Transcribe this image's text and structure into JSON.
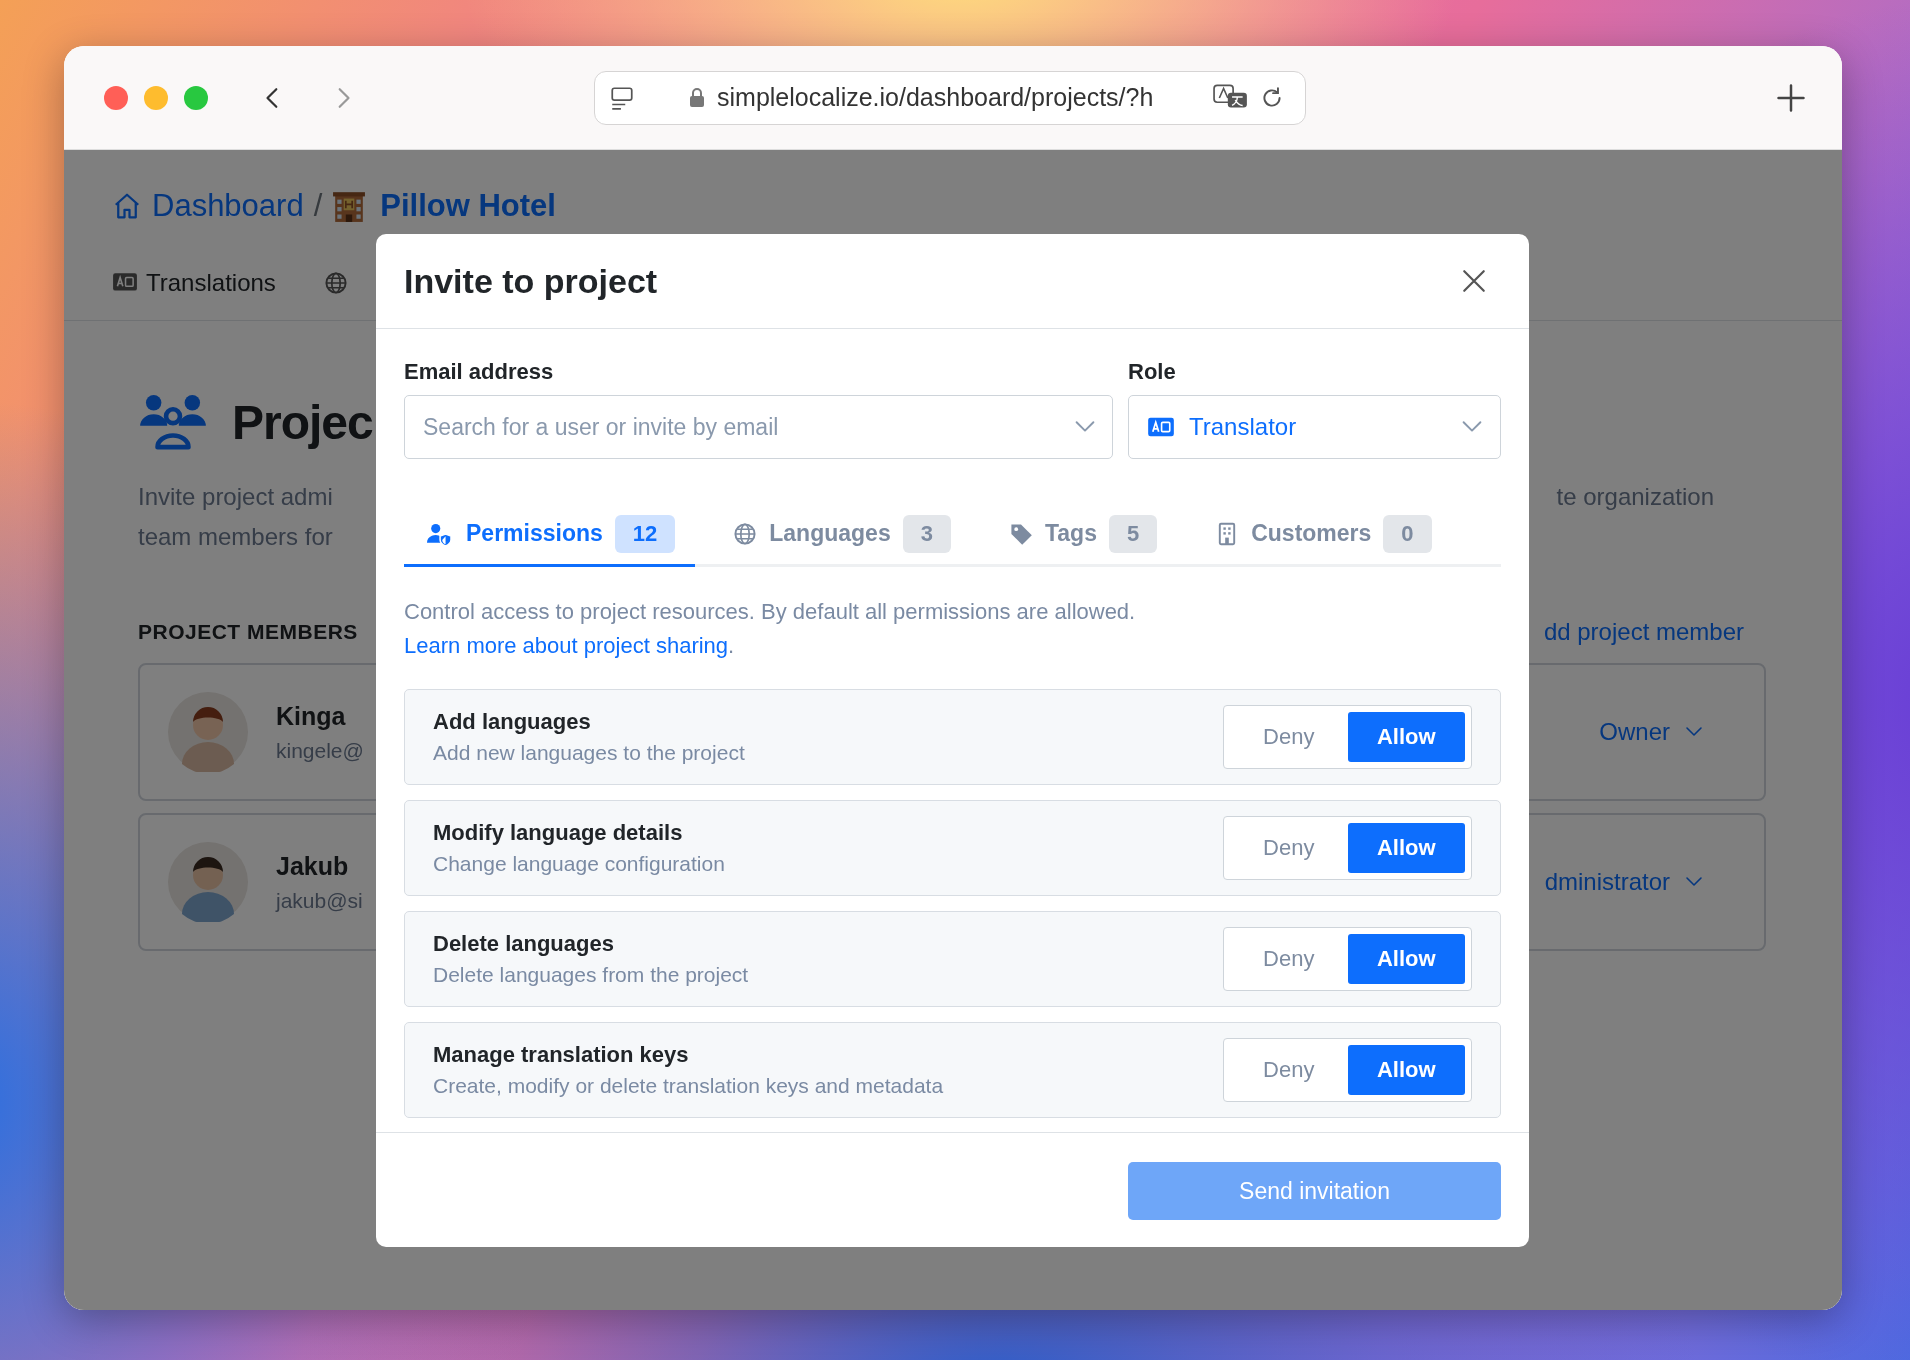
{
  "browser": {
    "address": "simplelocalize.io/dashboard/projects/?h"
  },
  "page": {
    "breadcrumbs": [
      {
        "label": "Dashboard"
      },
      {
        "label": "Pillow Hotel"
      }
    ],
    "breadcrumb_separator": "/",
    "nav_tabs": [
      {
        "label": "Translations"
      }
    ],
    "heading": "Projec",
    "description": {
      "line_1_left": "Invite project admi",
      "line_1_right": "te organization",
      "line_2_left": "team members for"
    },
    "members_heading": "PROJECT MEMBERS",
    "add_member_link": "dd project member",
    "members": [
      {
        "name": "Kinga",
        "email": "kingele@",
        "role": "Owner"
      },
      {
        "name": "Jakub",
        "email": "jakub@si",
        "role": "dministrator"
      }
    ]
  },
  "modal": {
    "title": "Invite to project",
    "email_field": {
      "label": "Email address",
      "placeholder": "Search for a user or invite by email"
    },
    "role_field": {
      "label": "Role",
      "value": "Translator"
    },
    "tabs": [
      {
        "label": "Permissions",
        "count": "12",
        "selected": true
      },
      {
        "label": "Languages",
        "count": "3",
        "selected": false
      },
      {
        "label": "Tags",
        "count": "5",
        "selected": false
      },
      {
        "label": "Customers",
        "count": "0",
        "selected": false
      }
    ],
    "description": {
      "text": "Control access to project resources. By default all permissions are allowed.",
      "link": "Learn more about project sharing",
      "suffix": "."
    },
    "permissions": [
      {
        "title": "Add languages",
        "description": "Add new languages to the project",
        "options": [
          {
            "label": "Deny",
            "selected": false
          },
          {
            "label": "Allow",
            "selected": true
          }
        ]
      },
      {
        "title": "Modify language details",
        "description": "Change language configuration",
        "options": [
          {
            "label": "Deny",
            "selected": false
          },
          {
            "label": "Allow",
            "selected": true
          }
        ]
      },
      {
        "title": "Delete languages",
        "description": "Delete languages from the project",
        "options": [
          {
            "label": "Deny",
            "selected": false
          },
          {
            "label": "Allow",
            "selected": true
          }
        ]
      },
      {
        "title": "Manage translation keys",
        "description": "Create, modify or delete translation keys and metadata",
        "options": [
          {
            "label": "Deny",
            "selected": false
          },
          {
            "label": "Allow",
            "selected": true
          }
        ]
      }
    ],
    "submit": {
      "label": "Send invitation",
      "disabled": true
    }
  }
}
